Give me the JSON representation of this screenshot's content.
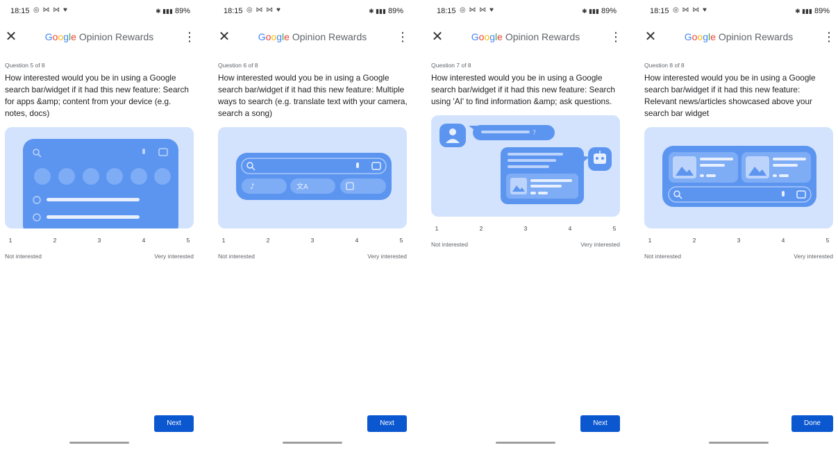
{
  "brand": {
    "google": [
      "G",
      "o",
      "o",
      "g",
      "l",
      "e"
    ],
    "suffix": "Opinion Rewards"
  },
  "colors": {
    "primary_button": "#0b57d0",
    "illustration_bg": "#d3e3fd",
    "illustration_accent": "#5c95f0"
  },
  "screens": [
    {
      "status": {
        "time": "18:15",
        "battery": "89%"
      },
      "counter": "Question 5 of 8",
      "question": "How interested would you be in using a Google search bar/widget if it had this new feature: Search for apps &amp; content from your device (e.g. notes, docs)",
      "illustration": "device-search-widget",
      "scale": [
        "1",
        "2",
        "3",
        "4",
        "5"
      ],
      "low_label": "Not interested",
      "high_label": "Very interested",
      "button": "Next"
    },
    {
      "status": {
        "time": "18:15",
        "battery": "89%"
      },
      "counter": "Question 6 of 8",
      "question": "How interested would you be in using a Google search bar/widget if it had this new feature: Multiple ways to search (e.g. translate text with your camera, search a song)",
      "illustration": "multi-mode-search-bar",
      "scale": [
        "1",
        "2",
        "3",
        "4",
        "5"
      ],
      "low_label": "Not interested",
      "high_label": "Very interested",
      "button": "Next"
    },
    {
      "status": {
        "time": "18:15",
        "battery": "89%"
      },
      "counter": "Question 7 of 8",
      "question": "How interested would you be in using a Google search bar/widget if it had this new feature: Search using 'AI' to find information &amp; ask questions.",
      "illustration": "ai-chat",
      "scale": [
        "1",
        "2",
        "3",
        "4",
        "5"
      ],
      "low_label": "Not interested",
      "high_label": "Very interested",
      "button": "Next"
    },
    {
      "status": {
        "time": "18:15",
        "battery": "89%"
      },
      "counter": "Question 8 of 8",
      "question": "How interested would you be in using a Google search bar/widget if it had this new feature: Relevant news/articles showcased above your search bar widget",
      "illustration": "news-above-search-bar",
      "scale": [
        "1",
        "2",
        "3",
        "4",
        "5"
      ],
      "low_label": "Not interested",
      "high_label": "Very interested",
      "button": "Done"
    }
  ]
}
